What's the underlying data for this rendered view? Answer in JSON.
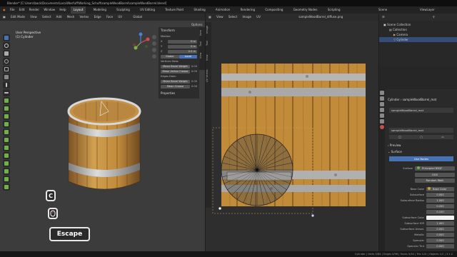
{
  "window": {
    "title": "Blender* [C:\\Users\\back\\Documents\\Local\\Nerfuff\\Working_Schuft\\sampleWoodBarrel\\sampleWoodBarrel.blend]"
  },
  "menu": {
    "items": [
      "File",
      "Edit",
      "Render",
      "Window",
      "Help"
    ],
    "workspaces": [
      "Layout",
      "Modeling",
      "Sculpting",
      "UV Editing",
      "Texture Paint",
      "Shading",
      "Animation",
      "Rendering",
      "Compositing",
      "Geometry Nodes",
      "Scripting"
    ],
    "active_workspace": "Layout",
    "scene": "Scene",
    "view_layer": "ViewLayer"
  },
  "viewport": {
    "mode": "Edit Mode",
    "menu": [
      "View",
      "Select",
      "Add",
      "Mesh",
      "Vertex",
      "Edge",
      "Face",
      "UV"
    ],
    "transform_orientation": "Global",
    "info_line1": "User Perspective",
    "info_line2": "(1) Cylinder",
    "options": "Options"
  },
  "npanel": {
    "transform_title": "Transform",
    "median": "Median:",
    "x": "X",
    "x_val": "0 m",
    "y": "Y",
    "y_val": "0 m",
    "z": "Z",
    "z_val": "0.5 m",
    "global": "Global",
    "local": "Local",
    "vertices_data": "Vertices Data:",
    "mean_bevel_weight": "Mean Bevel Weight",
    "mean_bevel_weight_val": "0.00",
    "mean_vertex_crease": "Mean Vertex Crease",
    "mean_vertex_crease_val": "0.00",
    "edges_data": "Edges Data:",
    "mean_bevel_weight_e": "Mean Bevel Weight",
    "mean_bevel_weight_e_val": "0.00",
    "mean_crease": "Mean Crease",
    "mean_crease_val": "0.00",
    "properties": "Properties",
    "tabs": [
      "Item",
      "Tool",
      "View"
    ]
  },
  "uv_editor": {
    "menu": [
      "View",
      "Select",
      "Image",
      "UV"
    ],
    "image_name": "sampleWoodBarrel_diffuse.png",
    "side_tabs": [
      "Image",
      "Tool",
      "View",
      "UV Vertex"
    ]
  },
  "outliner": {
    "title": "Scene Collection",
    "items": [
      "Collection",
      "Camera",
      "Cylinder"
    ]
  },
  "properties": {
    "object": "Cylinder",
    "material_slot": "sampleWoodBarrel_mat",
    "material_name": "sampleWoodBarrel_mat",
    "sections": [
      "Preview",
      "Surface"
    ],
    "use_nodes": "Use Nodes",
    "surface_label": "Surface",
    "surface_val": "Principled BSDF",
    "ggx": "GGX",
    "random_walk": "Random Walk",
    "rows": [
      {
        "label": "Base Color",
        "val": "Base Color"
      },
      {
        "label": "Subsurface",
        "val": "0.000"
      },
      {
        "label": "Subsurface Radius",
        "val": "1.000"
      },
      {
        "label": "",
        "val": "0.200"
      },
      {
        "label": "",
        "val": "0.100"
      },
      {
        "label": "Subsurface Color",
        "val": ""
      },
      {
        "label": "Subsurface IOR",
        "val": "1.400"
      },
      {
        "label": "Subsurface Anisot.",
        "val": "0.000"
      },
      {
        "label": "Metallic",
        "val": "0.000"
      },
      {
        "label": "Specular",
        "val": "0.500"
      },
      {
        "label": "Specular Tint",
        "val": "0.000"
      }
    ]
  },
  "statusbar": {
    "text": "Cylinder | Verts 0/64 | Edges 0/96 | Faces 0/34 | Tris 124 | Objects 1/2 | 3.1.2"
  },
  "keys": {
    "c": "C",
    "escape": "Escape"
  },
  "colors": {
    "accent": "#4772b3",
    "wood": "#c58d3a",
    "metal": "#b9b9b9",
    "active_tab": "#3d3d3d"
  }
}
